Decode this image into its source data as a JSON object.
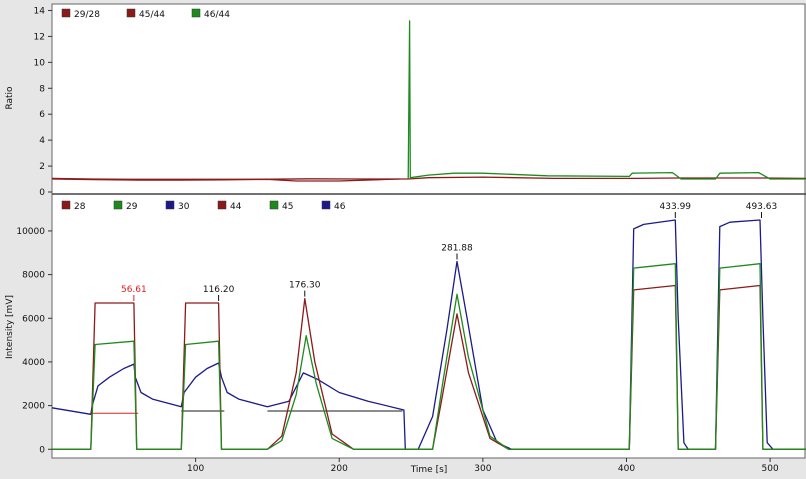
{
  "chart_data": [
    {
      "type": "line",
      "ylabel": "Ratio",
      "xlim": [
        0,
        525
      ],
      "ylim": [
        0,
        14.5
      ],
      "yticks": [
        0,
        2,
        4,
        6,
        8,
        10,
        12,
        14
      ],
      "grid": false,
      "legend_position": "top-left",
      "series": [
        {
          "name": "29/28",
          "color": "#8b1a1a",
          "points": [
            [
              0,
              1.05
            ],
            [
              28,
              1.0
            ],
            [
              60,
              0.98
            ],
            [
              120,
              0.98
            ],
            [
              145,
              0.98
            ],
            [
              180,
              1.02
            ],
            [
              215,
              1.0
            ],
            [
              242,
              1.0
            ]
          ]
        },
        {
          "name": "45/44",
          "color": "#8b1a1a",
          "points": [
            [
              0,
              1.0
            ],
            [
              28,
              0.96
            ],
            [
              60,
              0.92
            ],
            [
              90,
              0.92
            ],
            [
              120,
              0.94
            ],
            [
              150,
              0.98
            ],
            [
              170,
              0.85
            ],
            [
              200,
              0.85
            ],
            [
              242,
              1.0
            ],
            [
              248,
              1.0
            ],
            [
              262,
              1.1
            ],
            [
              300,
              1.15
            ],
            [
              350,
              1.05
            ],
            [
              402,
              1.05
            ],
            [
              435,
              1.08
            ],
            [
              465,
              1.08
            ],
            [
              495,
              1.08
            ],
            [
              525,
              1.05
            ]
          ]
        },
        {
          "name": "46/44",
          "color": "#1e8a1e",
          "points": [
            [
              248,
              1.0
            ],
            [
              249,
              13.2
            ],
            [
              249.5,
              1.1
            ],
            [
              262,
              1.3
            ],
            [
              280,
              1.45
            ],
            [
              300,
              1.45
            ],
            [
              345,
              1.25
            ],
            [
              402,
              1.2
            ],
            [
              404,
              1.45
            ],
            [
              432,
              1.5
            ],
            [
              438,
              1.0
            ],
            [
              462,
              1.0
            ],
            [
              465,
              1.45
            ],
            [
              492,
              1.5
            ],
            [
              500,
              1.0
            ],
            [
              525,
              1.0
            ]
          ]
        }
      ]
    },
    {
      "type": "line",
      "xlabel": "Time [s]",
      "ylabel": "Intensity [mV]",
      "xlim": [
        0,
        525
      ],
      "ylim": [
        -400,
        11600
      ],
      "xticks": [
        100,
        200,
        300,
        400,
        500
      ],
      "yticks": [
        0,
        2000,
        4000,
        6000,
        8000,
        10000
      ],
      "grid": false,
      "legend_position": "top-left",
      "legend": [
        {
          "name": "28",
          "color": "#8b1a1a"
        },
        {
          "name": "29",
          "color": "#1e8a1e"
        },
        {
          "name": "30",
          "color": "#1a1a8b"
        },
        {
          "name": "44",
          "color": "#8b1a1a"
        },
        {
          "name": "45",
          "color": "#1e8a1e"
        },
        {
          "name": "46",
          "color": "#1a1a8b"
        }
      ],
      "series": [
        {
          "name": "30",
          "color": "#1a1a8b",
          "points": [
            [
              0,
              1900
            ],
            [
              27,
              1600
            ],
            [
              28,
              2000
            ],
            [
              32,
              2900
            ],
            [
              40,
              3300
            ],
            [
              50,
              3700
            ],
            [
              57,
              3900
            ],
            [
              58,
              3300
            ],
            [
              62,
              2600
            ],
            [
              70,
              2300
            ],
            [
              90,
              1950
            ],
            [
              92,
              2600
            ],
            [
              100,
              3300
            ],
            [
              108,
              3700
            ],
            [
              116,
              3950
            ],
            [
              118,
              3300
            ],
            [
              122,
              2600
            ],
            [
              130,
              2300
            ],
            [
              150,
              1950
            ],
            [
              165,
              2200
            ],
            [
              175,
              3500
            ],
            [
              185,
              3200
            ],
            [
              200,
              2600
            ],
            [
              220,
              2200
            ],
            [
              245,
              1800
            ],
            [
              246,
              0
            ],
            [
              255,
              0
            ],
            [
              265,
              1500
            ],
            [
              275,
              5500
            ],
            [
              282,
              8600
            ],
            [
              289,
              6000
            ],
            [
              300,
              1800
            ],
            [
              310,
              300
            ],
            [
              320,
              0
            ],
            [
              402,
              0
            ],
            [
              405,
              10100
            ],
            [
              412,
              10300
            ],
            [
              434,
              10500
            ],
            [
              436,
              6000
            ],
            [
              440,
              300
            ],
            [
              443,
              0
            ],
            [
              462,
              0
            ],
            [
              465,
              10200
            ],
            [
              472,
              10400
            ],
            [
              493,
              10500
            ],
            [
              495,
              6000
            ],
            [
              498,
              300
            ],
            [
              502,
              0
            ],
            [
              525,
              0
            ]
          ]
        },
        {
          "name": "44",
          "color": "#8b1a1a",
          "points": [
            [
              0,
              0
            ],
            [
              27,
              0
            ],
            [
              30,
              6700
            ],
            [
              57,
              6700
            ],
            [
              59,
              0
            ],
            [
              90,
              0
            ],
            [
              93,
              6700
            ],
            [
              116,
              6700
            ],
            [
              118,
              0
            ],
            [
              150,
              0
            ],
            [
              160,
              600
            ],
            [
              170,
              3500
            ],
            [
              176,
              6900
            ],
            [
              183,
              4000
            ],
            [
              195,
              700
            ],
            [
              210,
              0
            ],
            [
              245,
              0
            ],
            [
              265,
              0
            ],
            [
              272,
              2500
            ],
            [
              282,
              6200
            ],
            [
              290,
              3500
            ],
            [
              305,
              500
            ],
            [
              318,
              0
            ],
            [
              402,
              0
            ],
            [
              405,
              7300
            ],
            [
              434,
              7500
            ],
            [
              436,
              0
            ],
            [
              462,
              0
            ],
            [
              465,
              7300
            ],
            [
              493,
              7500
            ],
            [
              495,
              0
            ],
            [
              525,
              0
            ]
          ]
        },
        {
          "name": "45",
          "color": "#1e8a1e",
          "points": [
            [
              0,
              0
            ],
            [
              27,
              0
            ],
            [
              30,
              4800
            ],
            [
              57,
              4950
            ],
            [
              59,
              0
            ],
            [
              90,
              0
            ],
            [
              93,
              4800
            ],
            [
              116,
              4950
            ],
            [
              118,
              0
            ],
            [
              150,
              0
            ],
            [
              160,
              400
            ],
            [
              170,
              2500
            ],
            [
              177,
              5200
            ],
            [
              184,
              3000
            ],
            [
              195,
              500
            ],
            [
              210,
              0
            ],
            [
              245,
              0
            ],
            [
              265,
              0
            ],
            [
              272,
              3000
            ],
            [
              282,
              7100
            ],
            [
              290,
              4200
            ],
            [
              305,
              600
            ],
            [
              318,
              0
            ],
            [
              402,
              0
            ],
            [
              405,
              8300
            ],
            [
              434,
              8500
            ],
            [
              436,
              0
            ],
            [
              462,
              0
            ],
            [
              465,
              8300
            ],
            [
              493,
              8500
            ],
            [
              495,
              0
            ],
            [
              525,
              0
            ]
          ]
        }
      ],
      "reference_lines": [
        {
          "color": "#e02020",
          "x": [
            27,
            60
          ],
          "y": 1650
        },
        {
          "color": "#1a1a1a",
          "x": [
            90,
            120
          ],
          "y": 1750
        },
        {
          "color": "#1a1a1a",
          "x": [
            150,
            244
          ],
          "y": 1750
        }
      ],
      "peak_labels": [
        {
          "x": 57,
          "y": 6700,
          "text": "56.61",
          "color": "#e02020"
        },
        {
          "x": 116,
          "y": 6700,
          "text": "116.20",
          "color": "#111111"
        },
        {
          "x": 176,
          "y": 6900,
          "text": "176.30",
          "color": "#111111"
        },
        {
          "x": 282,
          "y": 8600,
          "text": "281.88",
          "color": "#111111"
        },
        {
          "x": 434,
          "y": 10500,
          "text": "433.99",
          "color": "#111111"
        },
        {
          "x": 494,
          "y": 10500,
          "text": "493.63",
          "color": "#111111"
        }
      ]
    }
  ]
}
